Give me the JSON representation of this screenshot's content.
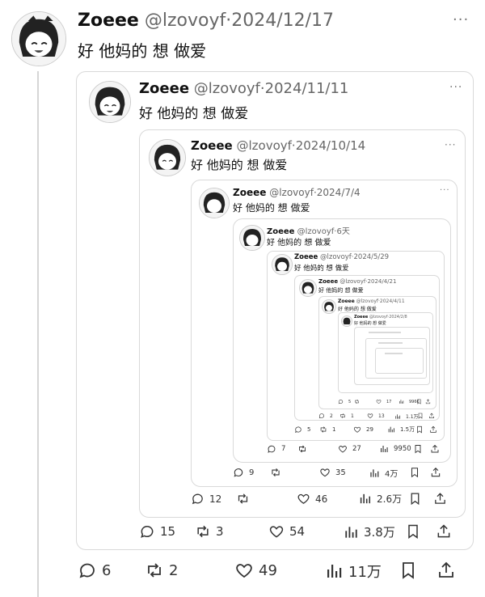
{
  "post": {
    "name": "Zoeee",
    "handle": "@lzovoyf",
    "date": "2024/12/17",
    "text": "好 他妈的 想 做爱",
    "more": "···",
    "stats": {
      "reply": "6",
      "retweet": "2",
      "like": "49",
      "views": "11万"
    }
  },
  "quotes": [
    {
      "date": "2024/11/11",
      "stats": {
        "reply": "15",
        "retweet": "3",
        "like": "54",
        "views": "3.8万"
      }
    },
    {
      "date": "2024/10/14",
      "stats": {
        "reply": "12",
        "retweet": "",
        "like": "46",
        "views": "2.6万"
      }
    },
    {
      "date": "2024/7/4",
      "stats": {
        "reply": "9",
        "retweet": "",
        "like": "35",
        "views": "4万"
      }
    },
    {
      "date": "6天",
      "stats": {
        "reply": "7",
        "retweet": "",
        "like": "27",
        "views": "9950"
      }
    },
    {
      "date": "2024/5/29",
      "stats": {
        "reply": "5",
        "retweet": "1",
        "like": "29",
        "views": "1.5万"
      }
    },
    {
      "date": "2024/4/21",
      "stats": {
        "reply": "2",
        "retweet": "1",
        "like": "13",
        "views": "1.1万"
      }
    },
    {
      "date": "2024/4/11",
      "stats": {
        "reply": "5",
        "retweet": "",
        "like": "17",
        "views": "9960"
      }
    },
    {
      "date": "2024/2/8"
    }
  ],
  "colors": {
    "border": "#d9d9d9",
    "muted": "#666666",
    "text": "#111111"
  }
}
